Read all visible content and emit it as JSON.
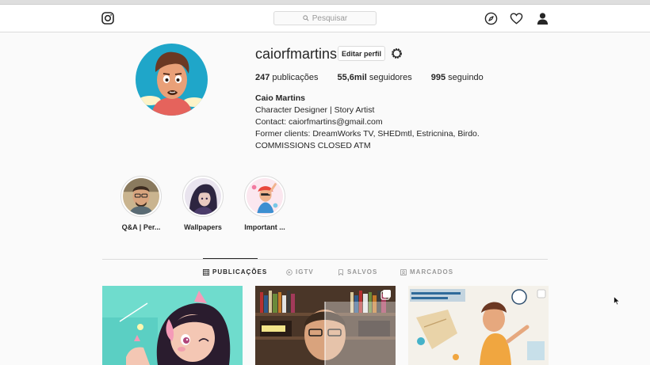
{
  "nav": {
    "logo_icon": "instagram-icon",
    "search_placeholder": "Pesquisar",
    "icons": [
      "compass-icon",
      "heart-icon",
      "user-icon"
    ]
  },
  "profile": {
    "username": "caiorfmartins",
    "edit_label": "Editar perfil",
    "stats": {
      "posts_count": "247",
      "posts_label": "publicações",
      "followers_count": "55,6mil",
      "followers_label": "seguidores",
      "following_count": "995",
      "following_label": "seguindo"
    },
    "bio": {
      "name": "Caio Martins",
      "line1": "Character Designer | Story Artist",
      "line2": "Contact: caiorfmartins@gmail.com",
      "line3": "Former clients: DreamWorks TV, SHEDmtl, Estricnina, Birdo.",
      "line4": "COMMISSIONS CLOSED ATM"
    }
  },
  "highlights": [
    {
      "label": "Q&A | Per..."
    },
    {
      "label": "Wallpapers"
    },
    {
      "label": "Important ..."
    }
  ],
  "tabs": [
    {
      "label": "PUBLICAÇÕES",
      "icon": "grid-icon",
      "active": true
    },
    {
      "label": "IGTV",
      "icon": "igtv-icon",
      "active": false
    },
    {
      "label": "SALVOS",
      "icon": "bookmark-icon",
      "active": false
    },
    {
      "label": "MARCADOS",
      "icon": "tagged-icon",
      "active": false
    }
  ],
  "posts": [
    {
      "name": "post-illustration-girl"
    },
    {
      "name": "post-photo-half-face"
    },
    {
      "name": "post-illustration-event"
    }
  ]
}
